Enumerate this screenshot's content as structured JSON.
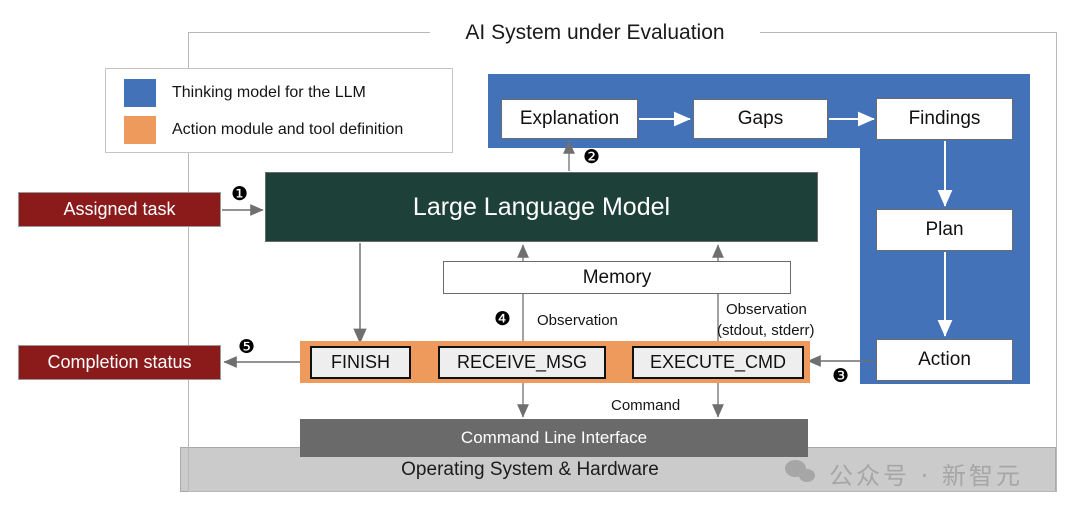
{
  "frame": {
    "title": "AI System under Evaluation"
  },
  "legend": {
    "items": [
      {
        "label": "Thinking model for the LLM",
        "color": "#4472b8",
        "swatch": "blue-swatch"
      },
      {
        "label": "Action module and tool definition",
        "color": "#ed9a5c",
        "swatch": "orange-swatch"
      }
    ]
  },
  "thinking_nodes": {
    "explanation": "Explanation",
    "gaps": "Gaps",
    "findings": "Findings",
    "plan": "Plan",
    "action": "Action"
  },
  "llm": {
    "label": "Large Language Model"
  },
  "memory": {
    "label": "Memory"
  },
  "tools": {
    "finish": "FINISH",
    "receive_msg": "RECEIVE_MSG",
    "execute_cmd": "EXECUTE_CMD"
  },
  "io": {
    "assigned_task": "Assigned task",
    "completion_status": "Completion status"
  },
  "edge_labels": {
    "observation": "Observation",
    "observation_streams_line1": "Observation",
    "observation_streams_line2": "(stdout, stderr)",
    "command": "Command"
  },
  "platform": {
    "cli": "Command Line Interface",
    "os": "Operating System & Hardware"
  },
  "markers": {
    "one": "❶",
    "two": "❷",
    "three": "❸",
    "four": "❹",
    "five": "❺"
  },
  "watermark": {
    "text": "公众号 · 新智元",
    "icon": "wechat-icon"
  },
  "colors": {
    "thinking_blue": "#4472b8",
    "action_orange": "#ed9a5c",
    "llm_teal": "#1d4038",
    "io_red": "#8b1a1a",
    "cli_gray": "#6a6a6a",
    "os_gray": "#cbcbcb"
  }
}
